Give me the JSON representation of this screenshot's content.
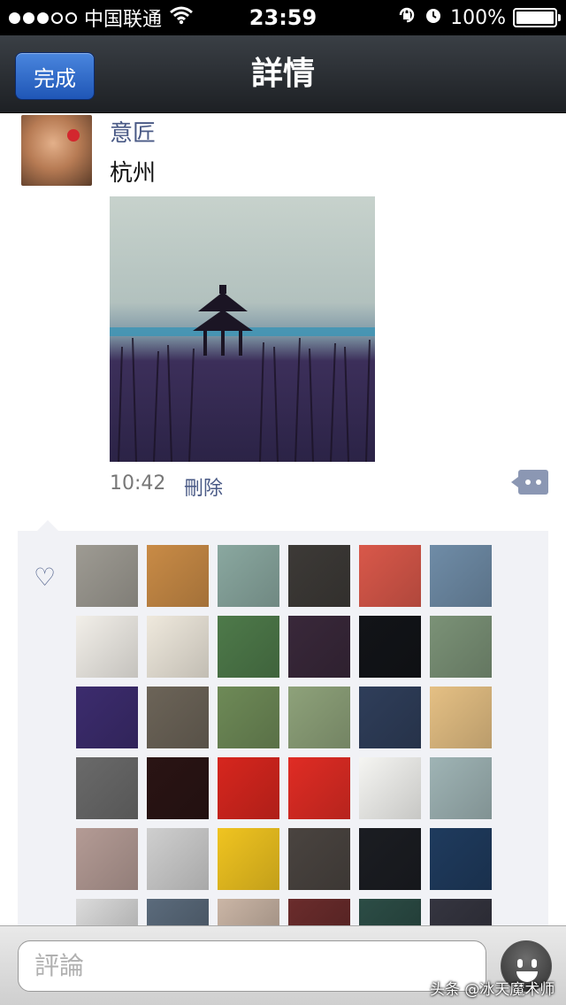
{
  "status_bar": {
    "carrier": "中国联通",
    "time": "23:59",
    "battery": "100%"
  },
  "nav": {
    "done_label": "完成",
    "title": "詳情"
  },
  "post": {
    "username": "意匠",
    "text": "杭州",
    "time": "10:42",
    "delete_label": "刪除"
  },
  "likes": {
    "avatar_colors": [
      "#9e9b93",
      "#c98b46",
      "#8aa8a0",
      "#3d3a37",
      "#d9584a",
      "#6f8ca7",
      "#f2efe9",
      "#efe9dd",
      "#4e7a4a",
      "#39283a",
      "#121418",
      "#7b9277",
      "#3c2c6e",
      "#6c6458",
      "#6e8a57",
      "#8ea27a",
      "#2f3e5a",
      "#e5c084",
      "#6a6a6a",
      "#2a1414",
      "#d7261e",
      "#e02c24",
      "#f5f5f2",
      "#9fb4b5",
      "#b49b95",
      "#cfcfcf",
      "#f0c420",
      "#4a4440",
      "#1b1d22",
      "#1f3b5e",
      "#dcdcdc",
      "#5b6b7c",
      "#cbb6a6",
      "#6b2c2c",
      "#2c4d46",
      "#353540"
    ]
  },
  "comment_bar": {
    "placeholder": "評論"
  },
  "watermark": "头条 @冰天魔术师"
}
